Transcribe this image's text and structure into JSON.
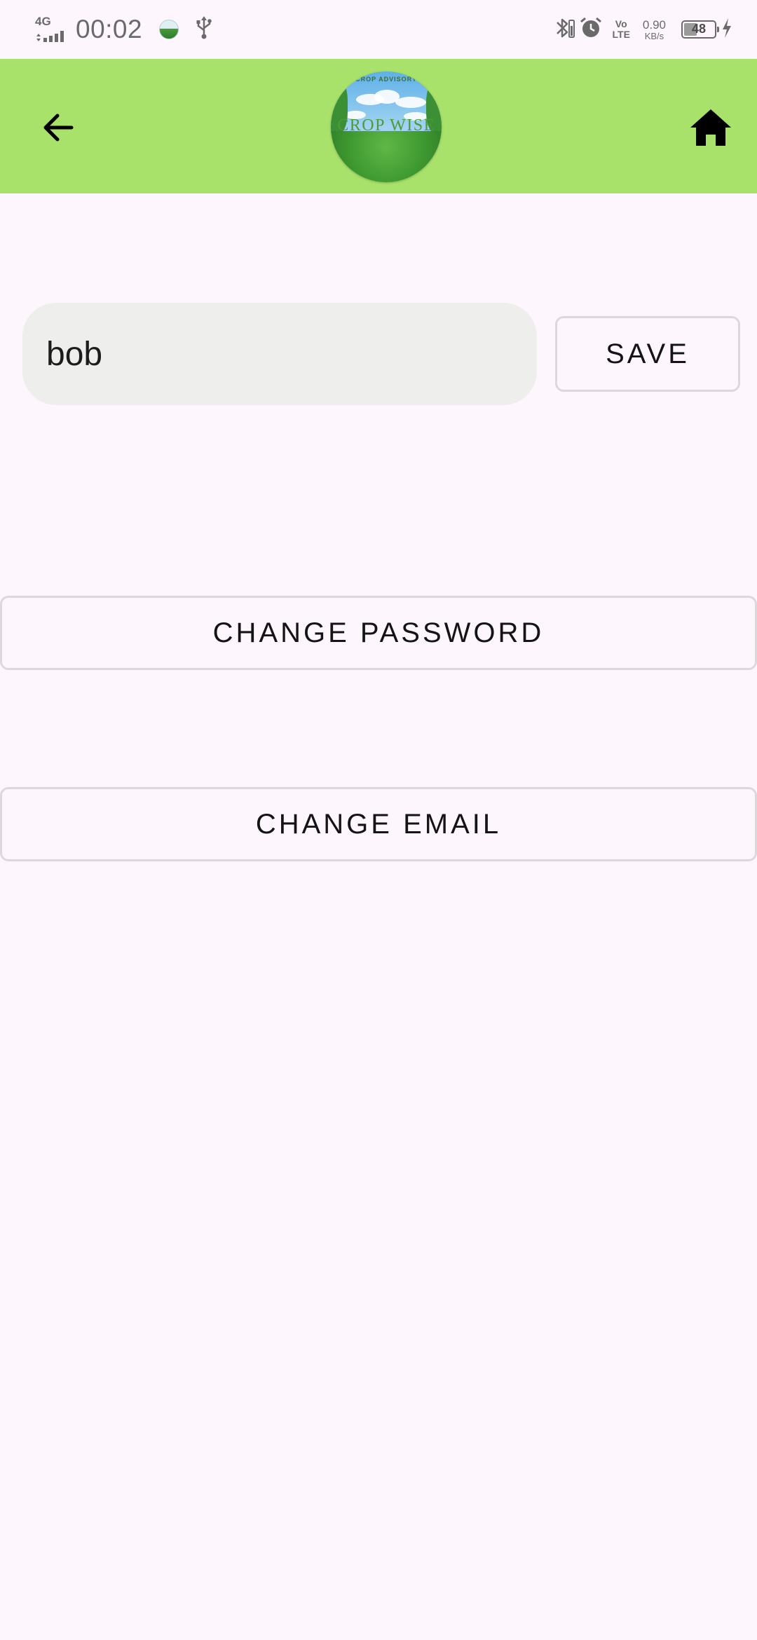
{
  "status_bar": {
    "network_type": "4G",
    "time": "00:02",
    "volte_top": "Vo",
    "volte_bottom": "LTE",
    "speed_value": "0.90",
    "speed_unit": "KB/s",
    "battery_level": "48",
    "battery_fraction": 0.48,
    "icons": [
      "signal-icon",
      "app-notification-icon",
      "usb-icon",
      "bluetooth-icon",
      "alarm-icon",
      "volte-icon",
      "battery-icon",
      "charging-icon"
    ]
  },
  "app_bar": {
    "background_color": "#a8e26a",
    "back_icon": "arrow-left-icon",
    "home_icon": "home-icon",
    "logo_top_text": "CROP ADVISORY",
    "logo_main_text": "CROP WISE"
  },
  "form": {
    "name_value": "bob",
    "save_label": "SAVE"
  },
  "actions": {
    "change_password_label": "CHANGE PASSWORD",
    "change_email_label": "CHANGE EMAIL"
  }
}
